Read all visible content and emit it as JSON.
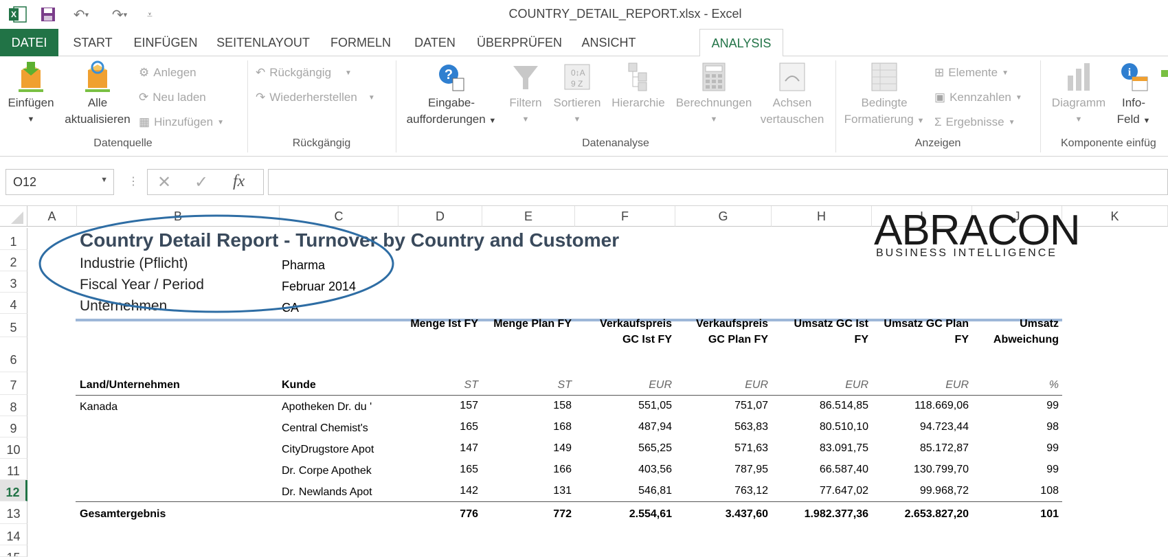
{
  "window": {
    "title": "COUNTRY_DETAIL_REPORT.xlsx - Excel"
  },
  "tabs": [
    "DATEI",
    "START",
    "EINFÜGEN",
    "SEITENLAYOUT",
    "FORMELN",
    "DATEN",
    "ÜBERPRÜFEN",
    "ANSICHT",
    "ANALYSIS"
  ],
  "ribbon": {
    "einfuegen": "Einfügen",
    "alle1": "Alle",
    "alle2": "aktualisieren",
    "anlegen": "Anlegen",
    "neu_laden": "Neu laden",
    "hinzufuegen": "Hinzufügen",
    "rueck": "Rückgängig",
    "wieder": "Wiederherstellen",
    "eingabe1": "Eingabe-",
    "eingabe2": "aufforderungen",
    "filtern": "Filtern",
    "sortieren": "Sortieren",
    "hierarchie": "Hierarchie",
    "berechnungen": "Berechnungen",
    "achsen1": "Achsen",
    "achsen2": "vertauschen",
    "bedingte1": "Bedingte",
    "bedingte2": "Formatierung",
    "elemente": "Elemente",
    "kennzahlen": "Kennzahlen",
    "ergebnisse": "Ergebnisse",
    "diagramm": "Diagramm",
    "info1": "Info-",
    "info2": "Feld",
    "groups": {
      "datenquelle": "Datenquelle",
      "rueckgaengig": "Rückgängig",
      "datenanalyse": "Datenanalyse",
      "anzeigen": "Anzeigen",
      "komponente": "Komponente einfüg"
    }
  },
  "formula_bar": {
    "name_box": "O12",
    "fx": "fx",
    "formula": ""
  },
  "columns": [
    "A",
    "B",
    "C",
    "D",
    "E",
    "F",
    "G",
    "H",
    "I",
    "J",
    "K"
  ],
  "rows": [
    "1",
    "2",
    "3",
    "4",
    "5",
    "6",
    "7",
    "8",
    "9",
    "10",
    "11",
    "12",
    "13",
    "14",
    "15"
  ],
  "report": {
    "title": "Country Detail Report - Turnover by Country and Customer",
    "filters": [
      {
        "label": "Industrie (Pflicht)",
        "value": "Pharma"
      },
      {
        "label": "Fiscal Year / Period",
        "value": "Februar 2014"
      },
      {
        "label": "Unternehmen",
        "value": "CA"
      }
    ],
    "logo": {
      "name": "ABRACON",
      "sub": "BUSINESS INTELLIGENCE"
    },
    "headers": {
      "land": "Land/Unternehmen",
      "kunde": "Kunde",
      "cols": [
        {
          "l1": "",
          "l2": "Menge Ist FY",
          "unit": "ST"
        },
        {
          "l1": "",
          "l2": "Menge Plan FY",
          "unit": "ST"
        },
        {
          "l1": "Verkaufspreis",
          "l2": "GC Ist FY",
          "unit": "EUR"
        },
        {
          "l1": "Verkaufspreis",
          "l2": "GC Plan FY",
          "unit": "EUR"
        },
        {
          "l1": "Umsatz GC Ist",
          "l2": "FY",
          "unit": "EUR"
        },
        {
          "l1": "Umsatz GC Plan",
          "l2": "FY",
          "unit": "EUR"
        },
        {
          "l1": "Umsatz",
          "l2": "Abweichung",
          "unit": "%"
        }
      ]
    },
    "country": "Kanada",
    "rows": [
      {
        "kunde": "Apotheken Dr. du '",
        "v": [
          "157",
          "158",
          "551,05",
          "751,07",
          "86.514,85",
          "118.669,06",
          "99"
        ]
      },
      {
        "kunde": "Central Chemist's",
        "v": [
          "165",
          "168",
          "487,94",
          "563,83",
          "80.510,10",
          "94.723,44",
          "98"
        ]
      },
      {
        "kunde": "CityDrugstore Apot",
        "v": [
          "147",
          "149",
          "565,25",
          "571,63",
          "83.091,75",
          "85.172,87",
          "99"
        ]
      },
      {
        "kunde": "Dr. Corpe Apothek",
        "v": [
          "165",
          "166",
          "403,56",
          "787,95",
          "66.587,40",
          "130.799,70",
          "99"
        ]
      },
      {
        "kunde": "Dr. Newlands Apot",
        "v": [
          "142",
          "131",
          "546,81",
          "763,12",
          "77.647,02",
          "99.968,72",
          "108"
        ]
      }
    ],
    "total": {
      "label": "Gesamtergebnis",
      "v": [
        "776",
        "772",
        "2.554,61",
        "3.437,60",
        "1.982.377,36",
        "2.653.827,20",
        "101"
      ]
    }
  },
  "colors": {
    "accent": "#217346",
    "annotation": "#2e6da4",
    "rule": "#9db7d8"
  }
}
